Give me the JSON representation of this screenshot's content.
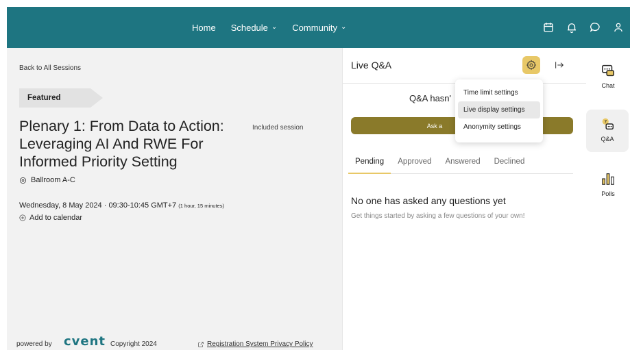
{
  "nav": {
    "items": [
      {
        "label": "Home",
        "has_dropdown": false
      },
      {
        "label": "Schedule",
        "has_dropdown": true
      },
      {
        "label": "Community",
        "has_dropdown": true
      }
    ],
    "icons": [
      "calendar-icon",
      "bell-icon",
      "chat-bubble-icon",
      "user-icon"
    ]
  },
  "session": {
    "back_label": "Back to All Sessions",
    "featured_label": "Featured",
    "title": "Plenary 1: From Data to Action: Leveraging AI And RWE For Informed Priority Setting",
    "included_label": "Included session",
    "location": "Ballroom A-C",
    "datetime": "Wednesday, 8 May 2024 · 09:30-10:45 GMT+7",
    "duration": "(1 hour, 15 minutes)",
    "add_calendar": "Add to calendar"
  },
  "footer": {
    "powered_by": "powered by",
    "logo_text": "cvent",
    "copyright": "Copyright 2024",
    "privacy": "Registration System Privacy Policy"
  },
  "qa": {
    "title": "Live Q&A",
    "notice": "Q&A hasn'",
    "ask_label": "Ask a",
    "tabs": [
      "Pending",
      "Approved",
      "Answered",
      "Declined"
    ],
    "active_tab": "Pending",
    "empty_title": "No one has asked any questions yet",
    "empty_subtitle": "Get things started by asking a few questions of your own!"
  },
  "settings_menu": {
    "items": [
      "Time limit settings",
      "Live display settings",
      "Anonymity settings"
    ],
    "highlighted": "Live display settings"
  },
  "rail": {
    "items": [
      {
        "label": "Chat"
      },
      {
        "label": "Q&A"
      },
      {
        "label": "Polls"
      }
    ],
    "selected": "Q&A"
  },
  "colors": {
    "header_bg": "#1e7581",
    "accent_gold": "#e8c867",
    "ask_button": "#8a7a2a",
    "left_panel_bg": "#f2f2f2"
  }
}
